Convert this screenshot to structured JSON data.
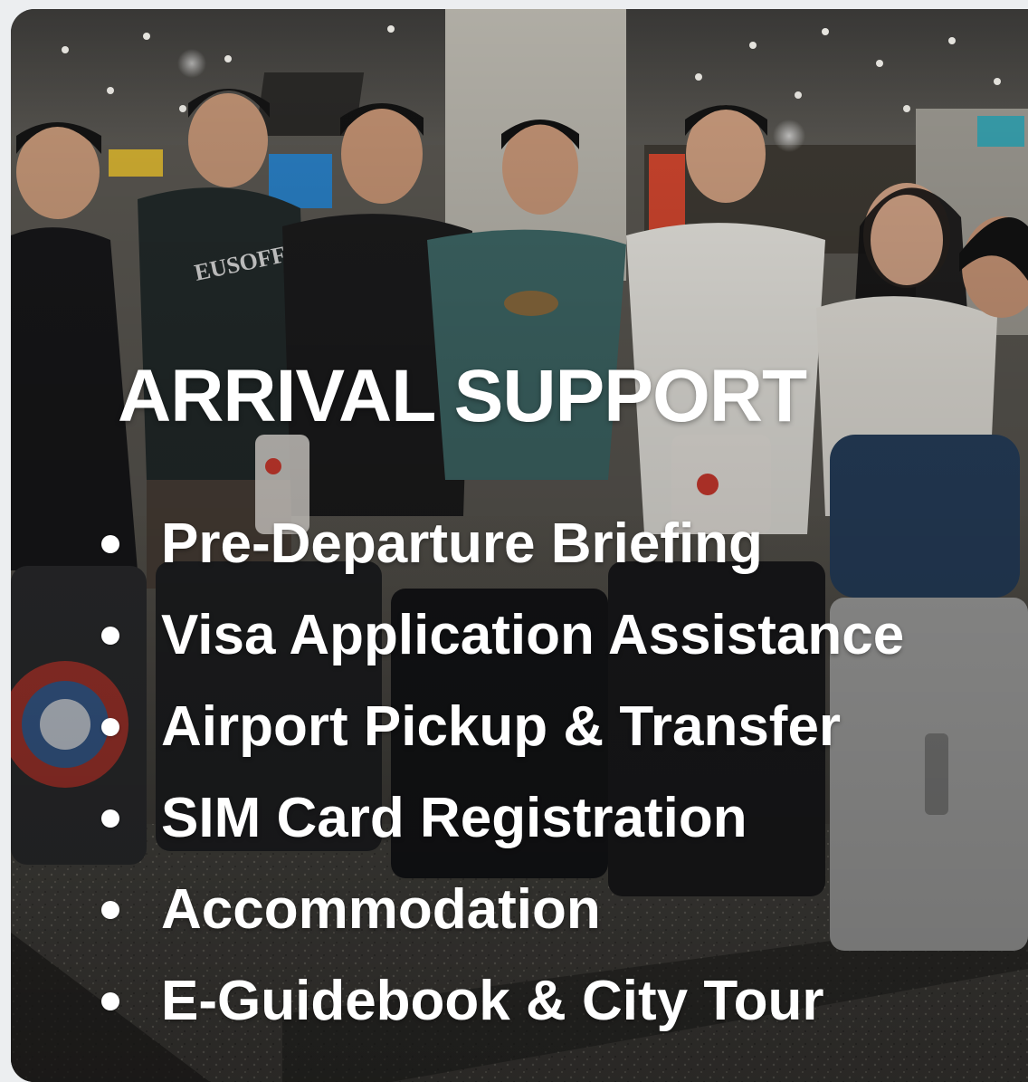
{
  "card": {
    "title": "ARRIVAL SUPPORT",
    "image_subject": "group-photo-airport-arrivals",
    "items": [
      "Pre-Departure Briefing",
      "Visa Application Assistance",
      "Airport Pickup & Transfer",
      "SIM Card Registration",
      "Accommodation",
      "E-Guidebook & City Tour"
    ]
  },
  "colors": {
    "text": "#ffffff",
    "page_background": "#eceef0"
  }
}
